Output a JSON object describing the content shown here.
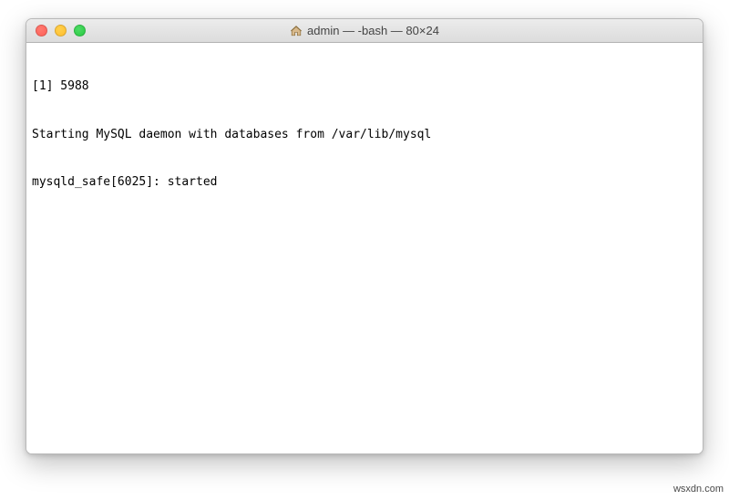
{
  "window": {
    "title": "admin — -bash — 80×24",
    "icon": "home-icon",
    "traffic": {
      "close_color": "#ff5f57",
      "minimize_color": "#ffbd2e",
      "zoom_color": "#28c940"
    }
  },
  "terminal": {
    "lines": [
      "[1] 5988",
      "Starting MySQL daemon with databases from /var/lib/mysql",
      "mysqld_safe[6025]: started"
    ]
  },
  "watermark": "wsxdn.com"
}
